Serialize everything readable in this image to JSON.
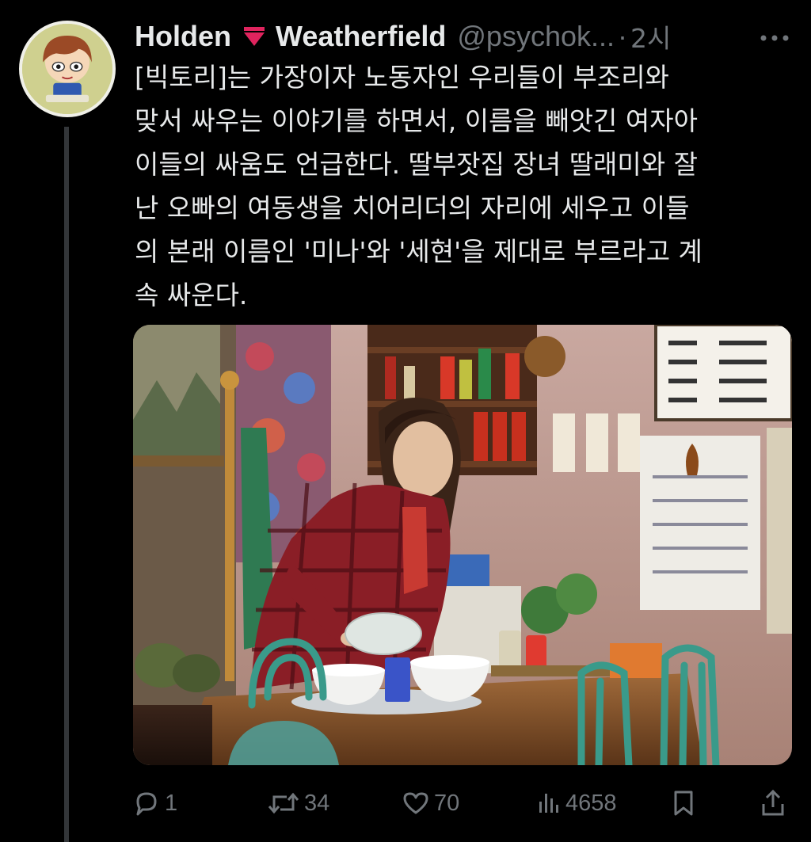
{
  "tweet": {
    "display_name_first": "Holden",
    "display_name_last": "Weatherfield",
    "flag_icon": "red-triangle-icon",
    "handle": "@psychok...",
    "separator": "·",
    "time": "2시",
    "text_lines": [
      "[빅토리]는 가장이자 노동자인 우리들이 부조리와",
      "맞서 싸우는 이야기를 하면서, 이름을 빼앗긴 여자아",
      "이들의 싸움도 언급한다. 딸부잣집 장녀 딸래미와 잘",
      "난 오빠의 여동생을 치어리더의 자리에 세우고 이들",
      "의 본래 이름인 '미나'와 '세현'을 제대로 부르라고 계",
      "속 싸운다."
    ]
  },
  "actions": {
    "reply_count": "1",
    "retweet_count": "34",
    "like_count": "70",
    "views_count": "4658"
  },
  "icons": {
    "more": "more-icon",
    "reply": "reply-icon",
    "retweet": "retweet-icon",
    "like": "heart-icon",
    "views": "views-icon",
    "bookmark": "bookmark-icon",
    "share": "share-icon"
  },
  "colors": {
    "background": "#000000",
    "text": "#e7e9ea",
    "secondary": "#71767b",
    "flag": "#e0245e"
  }
}
